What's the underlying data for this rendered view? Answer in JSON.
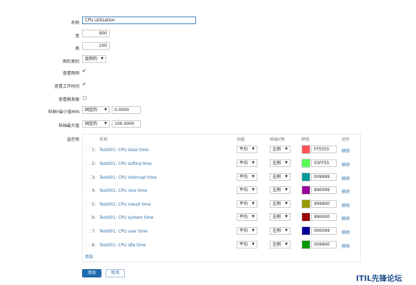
{
  "form": {
    "name": {
      "label": "名称",
      "value": "CPU utilization"
    },
    "width": {
      "label": "宽",
      "value": "900"
    },
    "height": {
      "label": "高",
      "value": "200"
    },
    "graph_type": {
      "label": "图形类别",
      "value": "层积的"
    },
    "show_legend": {
      "label": "查看图例",
      "checked": true
    },
    "show_work_period": {
      "label": "查看工作时间",
      "checked": true
    },
    "show_triggers": {
      "label": "查看触发器",
      "checked": false
    },
    "y_min": {
      "label": "纵轴Y最小值MIN",
      "type": "固定的",
      "value": "0.0000"
    },
    "y_max": {
      "label": "纵轴最大值",
      "type": "固定的",
      "value": "100.0000"
    },
    "items_label": "监控项"
  },
  "items_table": {
    "headers": {
      "name": "名称",
      "function": "功能",
      "y_axis": "纵轴Y侧",
      "color": "颜色",
      "action": "动作"
    },
    "rows": [
      {
        "num": "1:",
        "name": "Test001: CPU steal time",
        "function": "平均",
        "axis": "左侧",
        "color": "FF5555",
        "swatch": "#FF5555",
        "remove": "移除"
      },
      {
        "num": "2:",
        "name": "Test001: CPU softirq time",
        "function": "平均",
        "axis": "左侧",
        "color": "55FF55",
        "swatch": "#55FF55",
        "remove": "移除"
      },
      {
        "num": "3:",
        "name": "Test001: CPU interrupt time",
        "function": "平均",
        "axis": "左侧",
        "color": "009999",
        "swatch": "#009999",
        "remove": "移除"
      },
      {
        "num": "4:",
        "name": "Test001: CPU nice time",
        "function": "平均",
        "axis": "左侧",
        "color": "990099",
        "swatch": "#990099",
        "remove": "移除"
      },
      {
        "num": "5:",
        "name": "Test001: CPU iowait time",
        "function": "平均",
        "axis": "左侧",
        "color": "999900",
        "swatch": "#999900",
        "remove": "移除"
      },
      {
        "num": "6:",
        "name": "Test001: CPU system time",
        "function": "平均",
        "axis": "左侧",
        "color": "990000",
        "swatch": "#990000",
        "remove": "移除"
      },
      {
        "num": "7:",
        "name": "Test001: CPU user time",
        "function": "平均",
        "axis": "左侧",
        "color": "000099",
        "swatch": "#000099",
        "remove": "移除"
      },
      {
        "num": "8:",
        "name": "Test001: CPU idle time",
        "function": "平均",
        "axis": "左侧",
        "color": "009900",
        "swatch": "#009900",
        "remove": "移除"
      }
    ],
    "add_link": "添加"
  },
  "buttons": {
    "add": "添加",
    "cancel": "取消"
  },
  "watermark": "ITIL先锋论坛",
  "colors": {
    "link": "#2e6ea6",
    "primary_button": "#1f6cb0",
    "focus_border": "#3a7fc1"
  }
}
